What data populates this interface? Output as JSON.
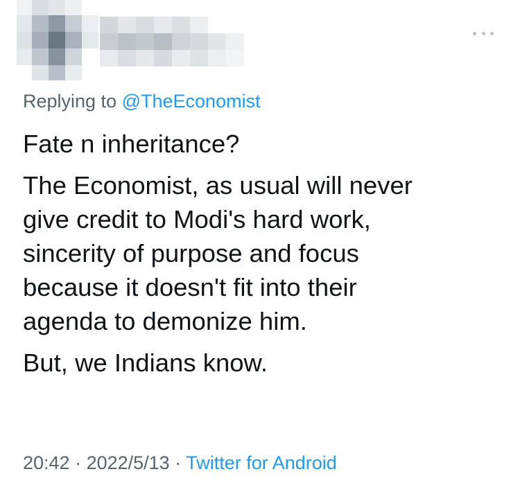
{
  "tweet": {
    "reply_prefix": "Replying to ",
    "reply_handle": "@TheEconomist",
    "paragraphs": [
      [
        "Fate n inheritance?"
      ],
      [
        "The Economist, as usual will never",
        "give credit to Modi's hard work,",
        "sincerity of purpose and focus",
        "because it doesn't fit into their",
        "agenda to demonize him."
      ],
      [
        "But, we Indians know."
      ]
    ],
    "time": "20:42",
    "separator": " · ",
    "date": "2022/5/13",
    "source": "Twitter for Android"
  },
  "icons": {
    "more": "more-horizontal-icon"
  },
  "colors": {
    "text": "#0f1419",
    "secondary": "#536471",
    "link": "#1d9bf0"
  }
}
